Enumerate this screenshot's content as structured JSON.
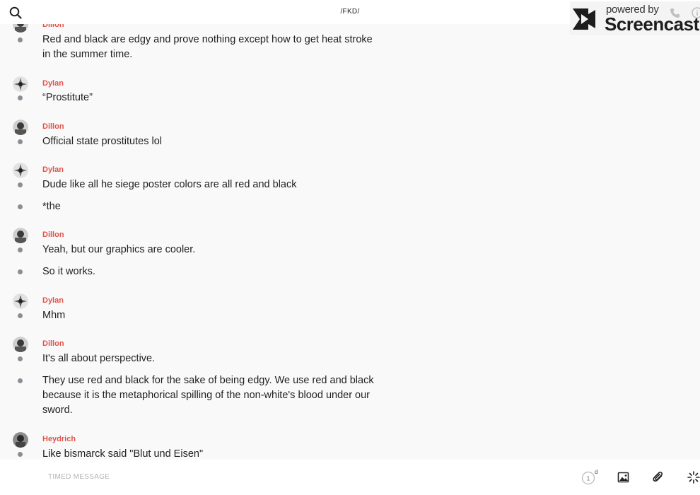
{
  "header": {
    "title": "/FKD/",
    "search_icon": "search-icon"
  },
  "watermark": {
    "powered_text": "powered by",
    "brand_text": "Screencastify"
  },
  "messages": [
    {
      "author": "Dillon",
      "lines": [
        "Red and black are edgy and prove nothing except how to get heat stroke in the summer time."
      ]
    },
    {
      "author": "Dylan",
      "lines": [
        "“Prostitute”"
      ]
    },
    {
      "author": "Dillon",
      "lines": [
        "Official state prostitutes lol"
      ]
    },
    {
      "author": "Dylan",
      "lines": [
        "Dude like all he siege poster colors are all red and black",
        "*the"
      ]
    },
    {
      "author": "Dillon",
      "lines": [
        "Yeah, but our graphics are cooler.",
        "So it works."
      ]
    },
    {
      "author": "Dylan",
      "lines": [
        "Mhm"
      ]
    },
    {
      "author": "Dillon",
      "lines": [
        "It's all about perspective.",
        "They use red and black for the sake of being edgy. We use red and black because it is the metaphorical spilling of the non-white's blood under our sword."
      ]
    },
    {
      "author": "Heydrich",
      "lines": [
        "Like bismarck said \"Blut und Eisen\""
      ]
    }
  ],
  "composer": {
    "placeholder": "TIMED MESSAGE",
    "timer_value": "1",
    "timer_unit": "d",
    "icons": [
      "timer-icon",
      "image-icon",
      "attachment-icon",
      "burst-icon"
    ]
  },
  "colors": {
    "author": "#e0534a",
    "bullet": "#8a8e95",
    "background": "#f9f9fa"
  }
}
